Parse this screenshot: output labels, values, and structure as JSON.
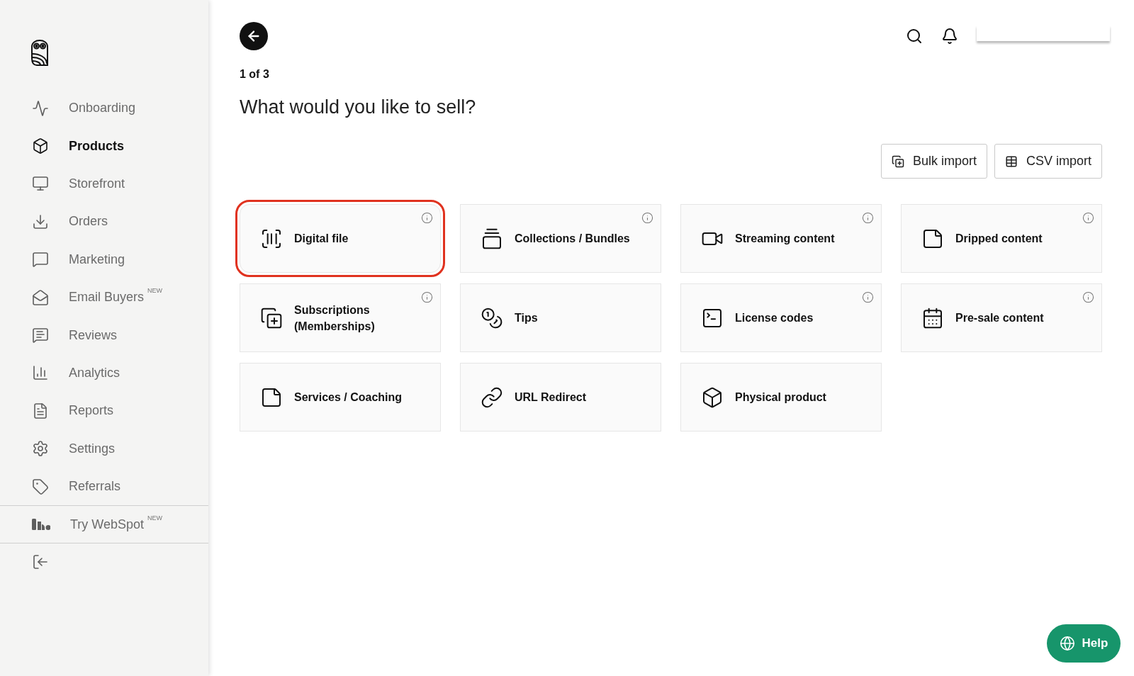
{
  "sidebar": {
    "items": [
      {
        "label": "Onboarding",
        "selected": false
      },
      {
        "label": "Products",
        "selected": true
      },
      {
        "label": "Storefront",
        "selected": false
      },
      {
        "label": "Orders",
        "selected": false
      },
      {
        "label": "Marketing",
        "selected": false
      },
      {
        "label": "Email Buyers",
        "badge": "NEW",
        "selected": false
      },
      {
        "label": "Reviews",
        "selected": false
      },
      {
        "label": "Analytics",
        "selected": false
      },
      {
        "label": "Reports",
        "selected": false
      },
      {
        "label": "Settings",
        "selected": false
      },
      {
        "label": "Referrals",
        "selected": false
      }
    ],
    "promo": {
      "label": "Try WebSpot",
      "badge": "NEW"
    }
  },
  "header": {
    "step": "1 of 3",
    "title": "What would you like to sell?"
  },
  "actions": [
    "Bulk import",
    "CSV import"
  ],
  "product_types": [
    {
      "label": "Digital file",
      "info": true,
      "highlighted": true
    },
    {
      "label": "Collections / Bundles",
      "info": true,
      "highlighted": false
    },
    {
      "label": "Streaming content",
      "info": true,
      "highlighted": false
    },
    {
      "label": "Dripped content",
      "info": true,
      "highlighted": false
    },
    {
      "label": "Subscriptions (Memberships)",
      "info": true,
      "highlighted": false
    },
    {
      "label": "Tips",
      "info": false,
      "highlighted": false
    },
    {
      "label": "License codes",
      "info": true,
      "highlighted": false
    },
    {
      "label": "Pre-sale content",
      "info": true,
      "highlighted": false
    },
    {
      "label": "Services / Coaching",
      "info": false,
      "highlighted": false
    },
    {
      "label": "URL Redirect",
      "info": false,
      "highlighted": false
    },
    {
      "label": "Physical product",
      "info": false,
      "highlighted": false
    }
  ],
  "help": {
    "label": "Help"
  }
}
